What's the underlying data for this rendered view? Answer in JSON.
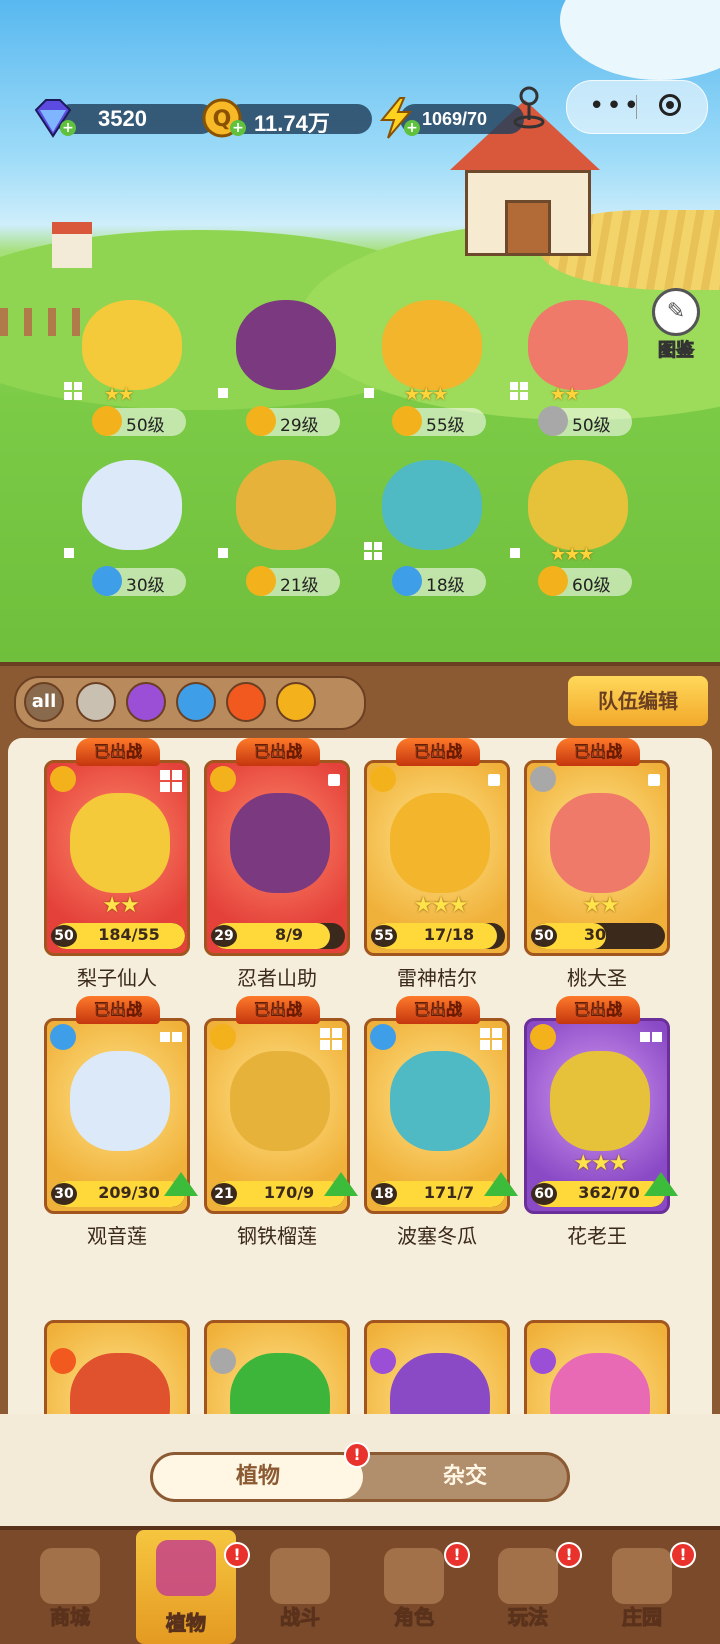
{
  "hud": {
    "gems": "3520",
    "coins": "11.74万",
    "energy": "1069/70"
  },
  "atlas_label": "图鉴",
  "field_units": [
    {
      "level": "50级",
      "element": "lightning",
      "stars": "★★"
    },
    {
      "level": "29级",
      "element": "lightning",
      "stars": ""
    },
    {
      "level": "55级",
      "element": "lightning",
      "stars": "★★★"
    },
    {
      "level": "50级",
      "element": "sword",
      "stars": "★★"
    },
    {
      "level": "30级",
      "element": "water",
      "stars": ""
    },
    {
      "level": "21级",
      "element": "lightning",
      "stars": ""
    },
    {
      "level": "18级",
      "element": "water",
      "stars": ""
    },
    {
      "level": "60级",
      "element": "lightning",
      "stars": "★★★"
    }
  ],
  "filters": {
    "all_label": "all",
    "icons": [
      "sword-icon",
      "potion-icon",
      "water-drop-icon",
      "fire-icon",
      "lightning-icon"
    ]
  },
  "team_edit_label": "队伍编辑",
  "deployed_label": "已出战",
  "cards": [
    {
      "name": "梨子仙人",
      "level": "50",
      "progress": "184/55",
      "fill": 1.0,
      "frame": "red",
      "stars": "★★",
      "element": "lightning"
    },
    {
      "name": "忍者山助",
      "level": "29",
      "progress": "8/9",
      "fill": 0.89,
      "frame": "red",
      "stars": "",
      "element": "lightning"
    },
    {
      "name": "雷神桔尔",
      "level": "55",
      "progress": "17/18",
      "fill": 0.94,
      "frame": "gold",
      "stars": "★★★",
      "element": "lightning"
    },
    {
      "name": "桃大圣",
      "level": "50",
      "progress": "30/55",
      "fill": 0.55,
      "frame": "gold",
      "stars": "★★",
      "element": "sword"
    },
    {
      "name": "观音莲",
      "level": "30",
      "progress": "209/30",
      "fill": 1.0,
      "frame": "gold",
      "stars": "",
      "element": "water"
    },
    {
      "name": "钢铁榴莲",
      "level": "21",
      "progress": "170/9",
      "fill": 1.0,
      "frame": "gold",
      "stars": "",
      "element": "lightning"
    },
    {
      "name": "波塞冬瓜",
      "level": "18",
      "progress": "171/7",
      "fill": 1.0,
      "frame": "gold",
      "stars": "",
      "element": "water"
    },
    {
      "name": "花老王",
      "level": "60",
      "progress": "362/70",
      "fill": 1.0,
      "frame": "purple",
      "stars": "★★★",
      "element": "lightning"
    }
  ],
  "toggle": {
    "plants": "植物",
    "hybrid": "杂交"
  },
  "nav": [
    "商城",
    "植物",
    "战斗",
    "角色",
    "玩法",
    "庄园"
  ],
  "colors": {
    "lightning": "#f3b21c",
    "water": "#3f9ee8",
    "sword": "#a8a8a8",
    "fire": "#f2591f",
    "potion": "#9b4fd6"
  }
}
